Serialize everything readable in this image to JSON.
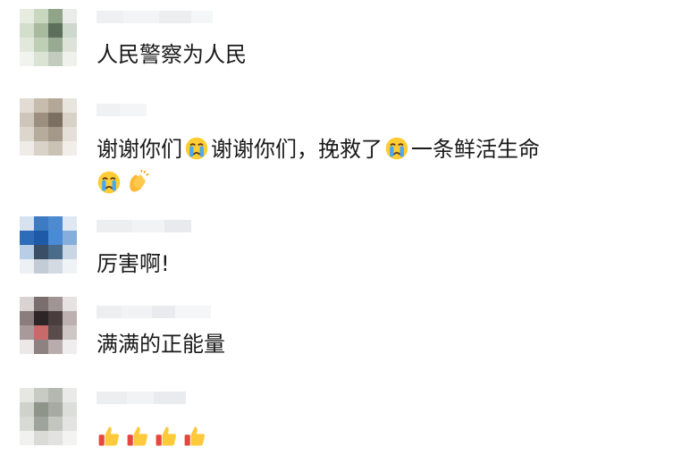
{
  "comments": [
    {
      "text": "人民警察为人民"
    },
    {
      "line1_a": "谢谢你们",
      "line1_b": "谢谢你们，挽救了",
      "line1_c": "一条鲜活生命"
    },
    {
      "text": "厉害啊!"
    },
    {
      "text": "满满的正能量"
    },
    {
      "text": ""
    }
  ],
  "icons": [
    "crying-face-emoji",
    "clapping-hands-emoji",
    "thumbs-up-emoji"
  ]
}
